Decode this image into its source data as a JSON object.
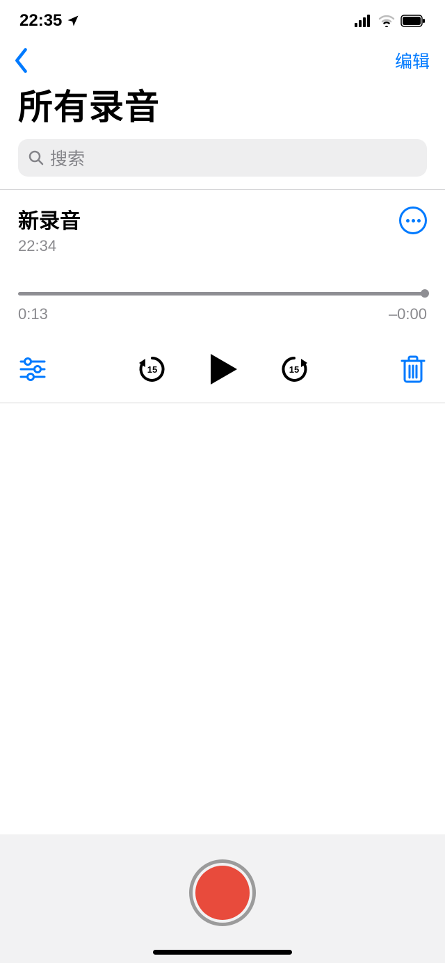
{
  "status": {
    "time": "22:35"
  },
  "nav": {
    "edit_label": "编辑"
  },
  "page": {
    "title": "所有录音"
  },
  "search": {
    "placeholder": "搜索"
  },
  "recording": {
    "title": "新录音",
    "timestamp": "22:34",
    "elapsed": "0:13",
    "remaining": "–0:00"
  }
}
